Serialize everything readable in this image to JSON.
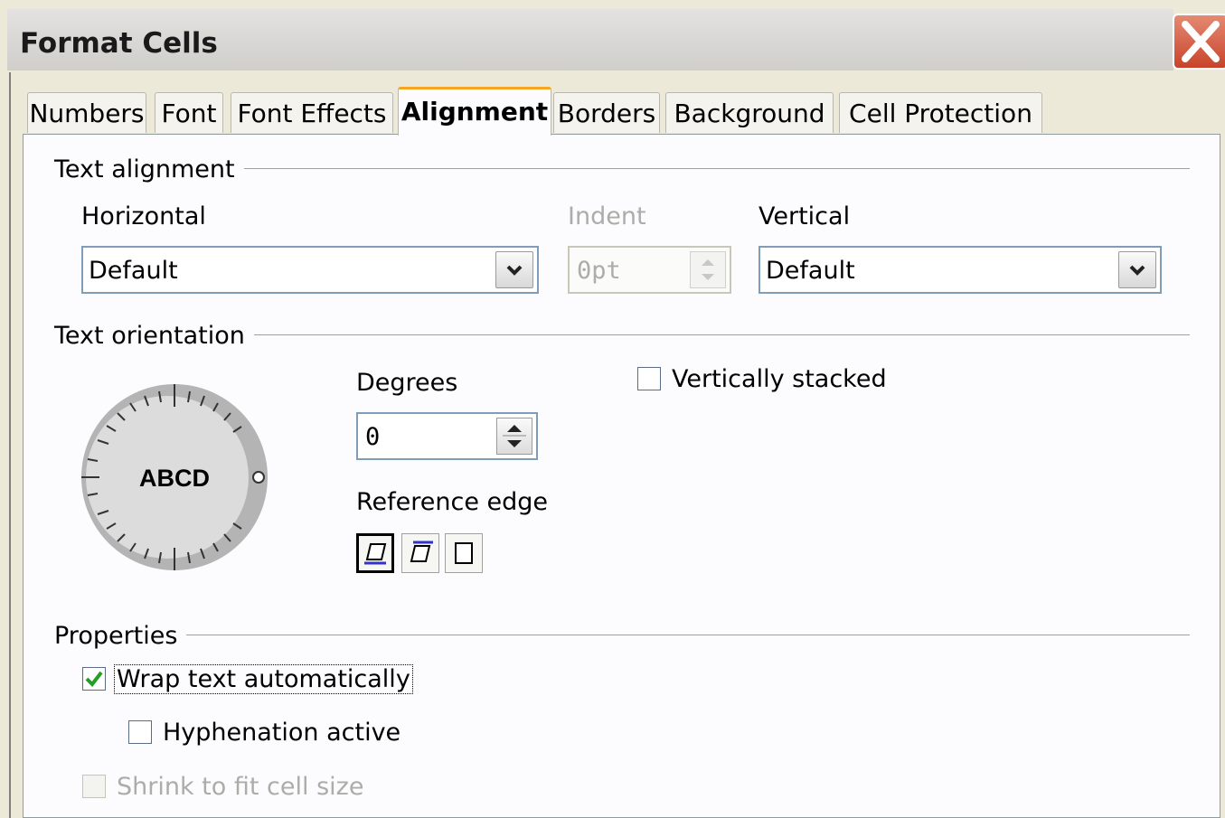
{
  "window": {
    "title": "Format Cells"
  },
  "tabs": [
    {
      "label": "Numbers"
    },
    {
      "label": "Font"
    },
    {
      "label": "Font Effects"
    },
    {
      "label": "Alignment"
    },
    {
      "label": "Borders"
    },
    {
      "label": "Background"
    },
    {
      "label": "Cell Protection"
    }
  ],
  "active_tab": "Alignment",
  "text_alignment": {
    "section_label": "Text alignment",
    "horizontal": {
      "label": "Horizontal",
      "value": "Default"
    },
    "indent": {
      "label": "Indent",
      "value": "0pt",
      "enabled": false
    },
    "vertical": {
      "label": "Vertical",
      "value": "Default"
    }
  },
  "text_orientation": {
    "section_label": "Text orientation",
    "dial_text": "ABCD",
    "degrees": {
      "label": "Degrees",
      "value": "0"
    },
    "reference_edge": {
      "label": "Reference edge",
      "selected_index": 0
    },
    "vertically_stacked": {
      "label": "Vertically stacked",
      "checked": false
    }
  },
  "properties": {
    "section_label": "Properties",
    "wrap_text": {
      "label": "Wrap text automatically",
      "checked": true
    },
    "hyphenation": {
      "label": "Hyphenation active",
      "checked": false
    },
    "shrink_to_fit": {
      "label": "Shrink to fit cell size",
      "checked": false,
      "enabled": false
    }
  },
  "colors": {
    "accent_tab": "#f5a623",
    "close_button": "#c8432a",
    "check_mark": "#21a121"
  }
}
